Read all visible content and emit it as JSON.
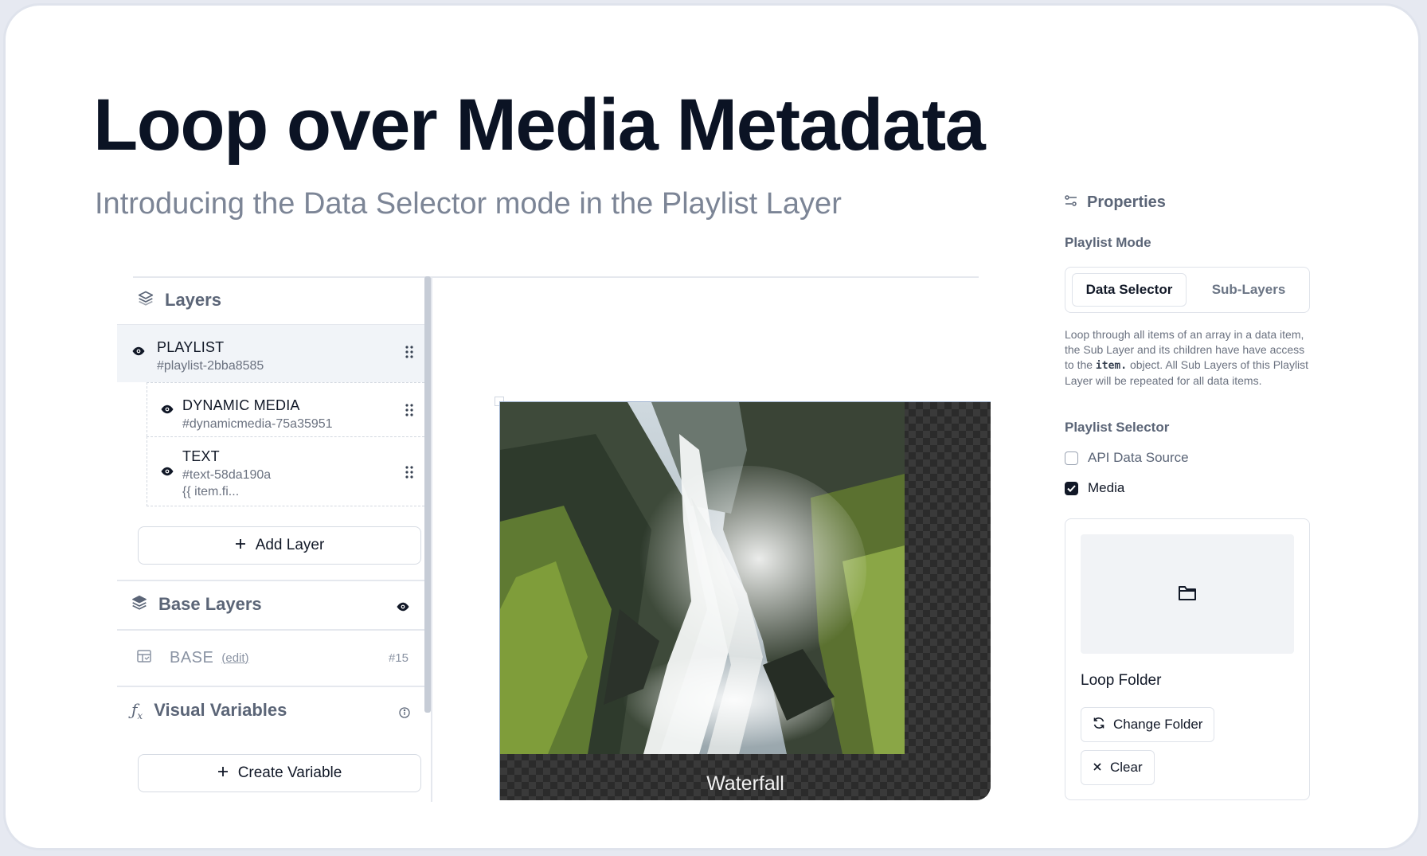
{
  "hero": {
    "title": "Loop over Media Metadata",
    "subtitle": "Introducing the Data Selector mode in the Playlist Layer"
  },
  "layers_panel": {
    "header": "Layers",
    "items": [
      {
        "name": "PLAYLIST",
        "id": "#playlist-2bba8585"
      },
      {
        "name": "DYNAMIC MEDIA",
        "id": "#dynamicmedia-75a35951"
      },
      {
        "name": "TEXT",
        "id": "#text-58da190a",
        "extra": "{{ item.fi..."
      }
    ],
    "add_layer_label": "Add Layer",
    "base_layers": {
      "header": "Base Layers",
      "item": {
        "name": "BASE",
        "edit_label": "(edit)",
        "number": "#15"
      }
    },
    "visual_variables": {
      "header": "Visual Variables",
      "create_label": "Create Variable"
    }
  },
  "preview": {
    "caption": "Waterfall"
  },
  "properties": {
    "title": "Properties",
    "mode_label": "Playlist Mode",
    "modes": [
      "Data Selector",
      "Sub-Layers"
    ],
    "selected_mode": "Data Selector",
    "description_before": "Loop through all items of an array in a data item, the Sub Layer and its children have have access to the ",
    "description_code": "item.",
    "description_after": " object. All Sub Layers of this Playlist Layer will be repeated for all data items.",
    "selector_label": "Playlist Selector",
    "options": [
      {
        "label": "API Data Source",
        "checked": false
      },
      {
        "label": "Media",
        "checked": true
      }
    ],
    "folder": {
      "name": "Loop Folder",
      "change_label": "Change Folder",
      "clear_label": "Clear"
    }
  },
  "colors": {
    "title": "#0b1324",
    "muted": "#5b6577",
    "border": "#dfe3ea",
    "active_row": "#f1f4f8"
  }
}
